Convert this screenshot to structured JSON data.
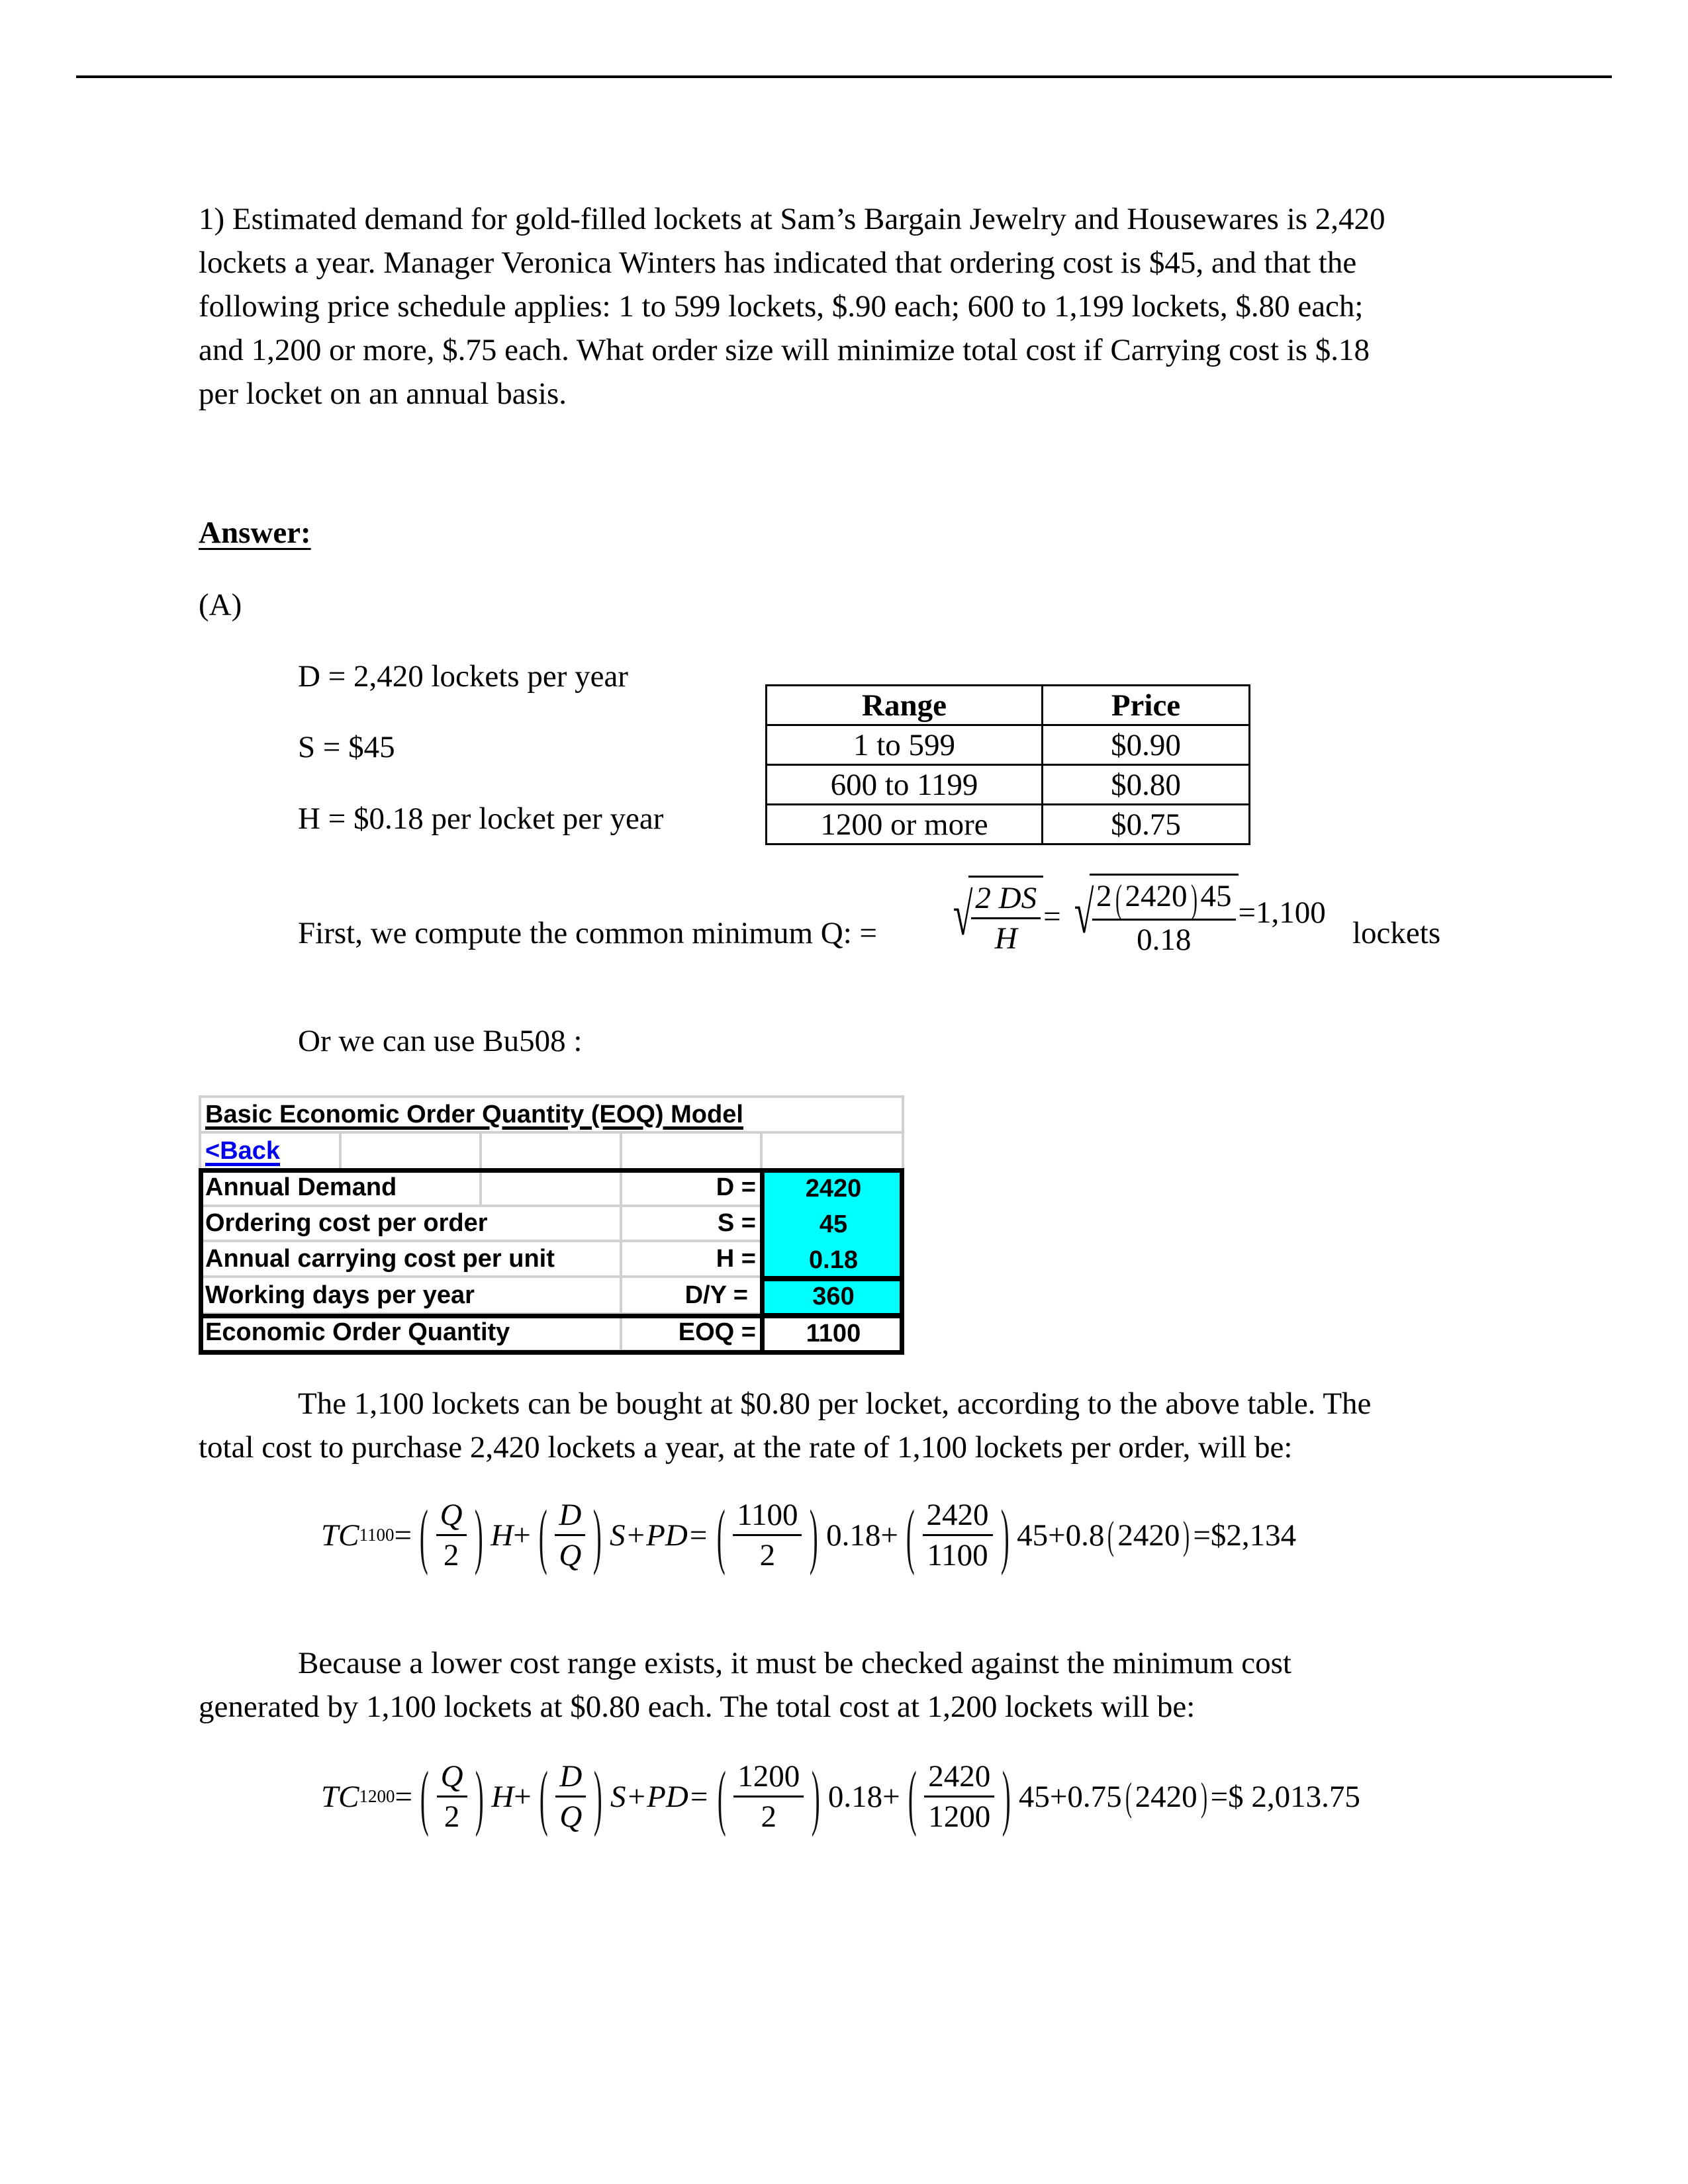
{
  "question": {
    "lines": [
      "1) Estimated demand for gold-filled lockets at Sam’s Bargain Jewelry and Housewares is 2,420",
      "lockets a year. Manager Veronica Winters has indicated that ordering cost is $45, and that the",
      "following price schedule applies: 1 to 599 lockets, $.90 each; 600 to 1,199 lockets, $.80 each;",
      "and 1,200 or more, $.75 each. What order size will minimize total cost if Carrying cost is $.18",
      "per locket on an annual basis."
    ]
  },
  "answer": {
    "heading": "Answer:",
    "part": "(A)",
    "given": [
      "D = 2,420 lockets per year",
      "S = $45",
      "H = $0.18 per locket per year"
    ]
  },
  "price_table": {
    "headers": [
      "Range",
      "Price"
    ],
    "rows": [
      [
        "1 to 599",
        "$0.90"
      ],
      [
        "600 to 1199",
        "$0.80"
      ],
      [
        "1200 or more",
        "$0.75"
      ]
    ]
  },
  "eoq_formula": {
    "intro": "First, we compute the common minimum Q: =",
    "sym_num": "2 DS",
    "sym_den": "H",
    "eq": "=",
    "val_num_a": "2",
    "val_num_b": "2420",
    "val_num_c": "45",
    "val_den": "0.18",
    "result": "=1,100",
    "unit": "lockets"
  },
  "alt_text": "Or we can use Bu508 :",
  "eoq_sheet": {
    "title": "Basic Economic Order Quantity (EOQ) Model",
    "back_link": "<Back",
    "rows": [
      {
        "label": "Annual Demand",
        "symbol": "D =",
        "value": "2420"
      },
      {
        "label": "Ordering cost per order",
        "symbol": "S =",
        "value": "45"
      },
      {
        "label": "Annual carrying cost per unit",
        "symbol": "H =",
        "value": "0.18"
      },
      {
        "label": "Working days per year",
        "symbol": "D/Y =",
        "value": "360"
      },
      {
        "label": "Economic Order Quantity",
        "symbol": "EOQ =",
        "value": "1100"
      }
    ],
    "input_color": "#00ffff"
  },
  "para1": [
    "The 1,100 lockets can be bought at $0.80 per locket, according to the above table. The",
    "total cost to purchase 2,420 lockets a year, at the rate of 1,100 lockets per order, will be:"
  ],
  "tc1100": {
    "lhs": "TC",
    "sub": "1100",
    "q": "Q",
    "two": "2",
    "h": "H",
    "plus": "+",
    "d": "D",
    "s": "S",
    "pd": "+PD=",
    "n1": "1100",
    "d1": "2",
    "v1": "0.18+",
    "n2": "2420",
    "d2": "1100",
    "tail_a": "45+0.8",
    "tail_b": "2420",
    "result": "=$2,134"
  },
  "para2": [
    "Because a lower cost range exists, it must be checked against the minimum cost",
    "generated by 1,100 lockets at $0.80 each. The total cost at 1,200 lockets will be:"
  ],
  "tc1200": {
    "lhs": "TC",
    "sub": "1200",
    "q": "Q",
    "two": "2",
    "h": "H",
    "plus": "+",
    "d": "D",
    "s": "S",
    "pd": "+PD=",
    "n1": "1200",
    "d1": "2",
    "v1": "0.18+",
    "n2": "2420",
    "d2": "1200",
    "tail_a": "45+0.75",
    "tail_b": "2420",
    "result": "=$ 2,013.75"
  }
}
